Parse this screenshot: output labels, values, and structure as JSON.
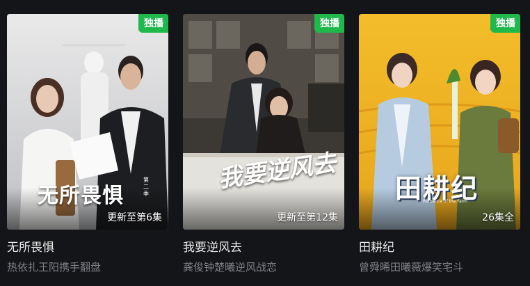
{
  "cards": [
    {
      "badge": "独播",
      "episodes": "更新至第6集",
      "poster_logo": "无所畏惧",
      "poster_logo_sub": "第二季",
      "title": "无所畏惧",
      "description": "热依扎王阳携手翻盘"
    },
    {
      "badge": "独播",
      "episodes": "更新至第12集",
      "poster_logo": "我要逆风去",
      "poster_logo_sub": "",
      "title": "我要逆风去",
      "description": "龚俊钟楚曦逆风战恋"
    },
    {
      "badge": "独播",
      "episodes": "26集全",
      "poster_logo": "田耕纪",
      "poster_logo_sub": "Romance of the Farm",
      "title": "田耕纪",
      "description": "曾舜晞田曦薇爆笑宅斗"
    }
  ],
  "colors": {
    "background": "#141518",
    "badge": "#1fb84a",
    "title": "#eaeaea",
    "description": "#7f8087"
  }
}
